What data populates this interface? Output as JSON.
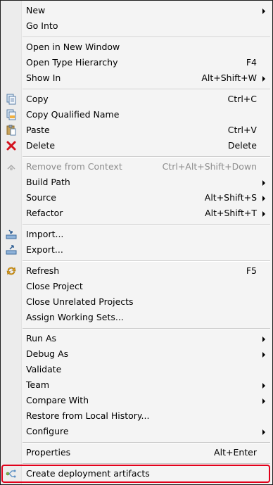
{
  "menu": {
    "items": [
      {
        "label": "New",
        "shortcut": "",
        "submenu": true
      },
      {
        "label": "Go Into",
        "shortcut": "",
        "submenu": false
      },
      {
        "label": "Open in New Window",
        "shortcut": "",
        "submenu": false
      },
      {
        "label": "Open Type Hierarchy",
        "shortcut": "F4",
        "submenu": false
      },
      {
        "label": "Show In",
        "shortcut": "Alt+Shift+W",
        "submenu": true
      },
      {
        "label": "Copy",
        "shortcut": "Ctrl+C",
        "submenu": false,
        "icon": "copy-icon"
      },
      {
        "label": "Copy Qualified Name",
        "shortcut": "",
        "submenu": false,
        "icon": "copy-qualified-name-icon"
      },
      {
        "label": "Paste",
        "shortcut": "Ctrl+V",
        "submenu": false,
        "icon": "paste-icon"
      },
      {
        "label": "Delete",
        "shortcut": "Delete",
        "submenu": false,
        "icon": "delete-icon"
      },
      {
        "label": "Remove from Context",
        "shortcut": "Ctrl+Alt+Shift+Down",
        "submenu": false,
        "disabled": true,
        "icon": "remove-from-context-icon"
      },
      {
        "label": "Build Path",
        "shortcut": "",
        "submenu": true
      },
      {
        "label": "Source",
        "shortcut": "Alt+Shift+S",
        "submenu": true
      },
      {
        "label": "Refactor",
        "shortcut": "Alt+Shift+T",
        "submenu": true
      },
      {
        "label": "Import...",
        "shortcut": "",
        "submenu": false,
        "icon": "import-icon"
      },
      {
        "label": "Export...",
        "shortcut": "",
        "submenu": false,
        "icon": "export-icon"
      },
      {
        "label": "Refresh",
        "shortcut": "F5",
        "submenu": false,
        "icon": "refresh-icon"
      },
      {
        "label": "Close Project",
        "shortcut": "",
        "submenu": false
      },
      {
        "label": "Close Unrelated Projects",
        "shortcut": "",
        "submenu": false
      },
      {
        "label": "Assign Working Sets...",
        "shortcut": "",
        "submenu": false
      },
      {
        "label": "Run As",
        "shortcut": "",
        "submenu": true
      },
      {
        "label": "Debug As",
        "shortcut": "",
        "submenu": true
      },
      {
        "label": "Validate",
        "shortcut": "",
        "submenu": false
      },
      {
        "label": "Team",
        "shortcut": "",
        "submenu": true
      },
      {
        "label": "Compare With",
        "shortcut": "",
        "submenu": true
      },
      {
        "label": "Restore from Local History...",
        "shortcut": "",
        "submenu": false
      },
      {
        "label": "Configure",
        "shortcut": "",
        "submenu": true
      },
      {
        "label": "Properties",
        "shortcut": "Alt+Enter",
        "submenu": false
      },
      {
        "label": "Create deployment artifacts",
        "shortcut": "",
        "submenu": false,
        "icon": "deployment-artifacts-icon",
        "highlighted": true
      }
    ]
  },
  "colors": {
    "highlight_border": "#e1001a",
    "disabled_text": "#8d8d8d",
    "menu_background": "#f4f4f4"
  }
}
